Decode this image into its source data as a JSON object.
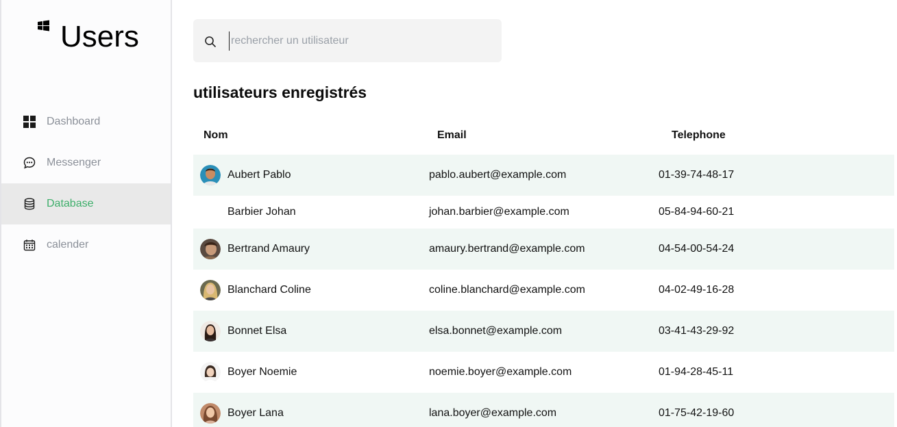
{
  "app": {
    "title": "Users",
    "brand_icon": "windows-logo-icon"
  },
  "sidebar": {
    "items": [
      {
        "label": "Dashboard",
        "icon": "dashboard-grid-icon",
        "active": false
      },
      {
        "label": "Messenger",
        "icon": "chat-bubble-icon",
        "active": false
      },
      {
        "label": "Database",
        "icon": "database-icon",
        "active": true
      },
      {
        "label": "calender",
        "icon": "calendar-icon",
        "active": false
      }
    ]
  },
  "search": {
    "placeholder": "rechercher un utilisateur",
    "value": "",
    "icon": "search-icon"
  },
  "main": {
    "title": "utilisateurs enregistrés"
  },
  "table": {
    "columns": [
      "Nom",
      "Email",
      "Telephone"
    ],
    "rows": [
      {
        "name": "Aubert Pablo",
        "email": "pablo.aubert@example.com",
        "phone": "01-39-74-48-17",
        "has_avatar": true
      },
      {
        "name": "Barbier Johan",
        "email": "johan.barbier@example.com",
        "phone": "05-84-94-60-21",
        "has_avatar": false
      },
      {
        "name": "Bertrand Amaury",
        "email": "amaury.bertrand@example.com",
        "phone": "04-54-00-54-24",
        "has_avatar": true
      },
      {
        "name": "Blanchard Coline",
        "email": "coline.blanchard@example.com",
        "phone": "04-02-49-16-28",
        "has_avatar": true
      },
      {
        "name": "Bonnet Elsa",
        "email": "elsa.bonnet@example.com",
        "phone": "03-41-43-29-92",
        "has_avatar": true
      },
      {
        "name": "Boyer Noemie",
        "email": "noemie.boyer@example.com",
        "phone": "01-94-28-45-11",
        "has_avatar": true
      },
      {
        "name": "Boyer Lana",
        "email": "lana.boyer@example.com",
        "phone": "01-75-42-19-60",
        "has_avatar": true
      }
    ]
  },
  "colors": {
    "accent": "#3dae6a",
    "row_alt": "#f0f7f4",
    "active_nav_bg": "#e9e9e9",
    "muted_text": "#8a8f98"
  }
}
